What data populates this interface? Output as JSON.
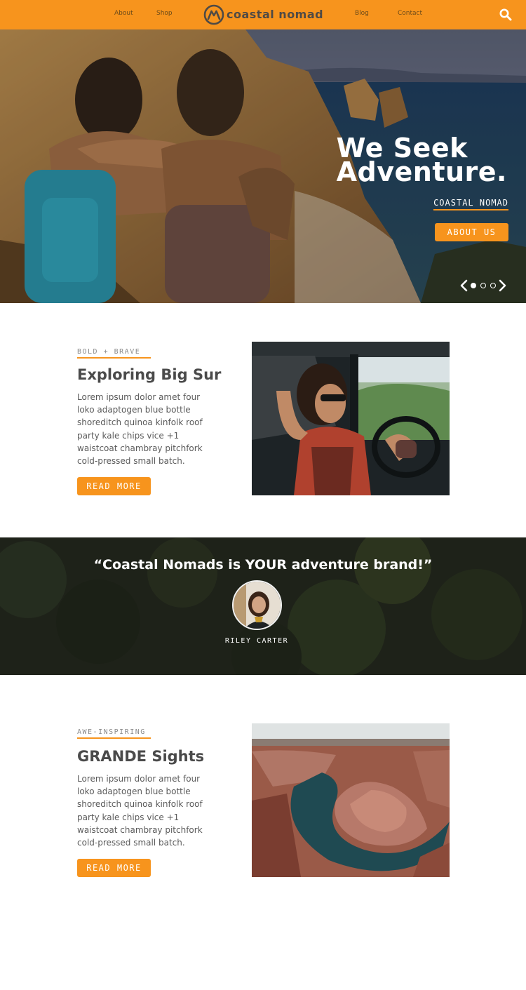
{
  "nav": {
    "links_left": [
      "About",
      "Shop"
    ],
    "brand": "coastal nomad",
    "links_right": [
      "Blog",
      "Contact"
    ],
    "search_icon": "search-icon"
  },
  "hero": {
    "title_line1": "We Seek",
    "title_line2": "Adventure.",
    "subtitle": "COASTAL NOMAD",
    "cta_label": "ABOUT US",
    "slides_count": 3,
    "active_slide": 1
  },
  "features": [
    {
      "kicker": "BOLD + BRAVE",
      "title": "Exploring Big Sur",
      "body": "Lorem ipsum dolor amet four loko adaptogen blue bottle shoreditch quinoa kinfolk roof party kale chips vice +1 waistcoat chambray pitchfork cold-pressed small batch.",
      "button": "READ MORE"
    },
    {
      "kicker": "AWE-INSPIRING",
      "title": "GRANDE Sights",
      "body": "Lorem ipsum dolor amet four loko adaptogen blue bottle shoreditch quinoa kinfolk roof party kale chips vice +1 waistcoat chambray pitchfork cold-pressed small batch.",
      "button": "READ MORE"
    }
  ],
  "testimonial": {
    "quote": "“Coastal Nomads is YOUR adventure brand!”",
    "author": "RILEY CARTER"
  },
  "colors": {
    "accent": "#f7941d",
    "text": "#4a4a4a",
    "forest": "#2f3527"
  }
}
